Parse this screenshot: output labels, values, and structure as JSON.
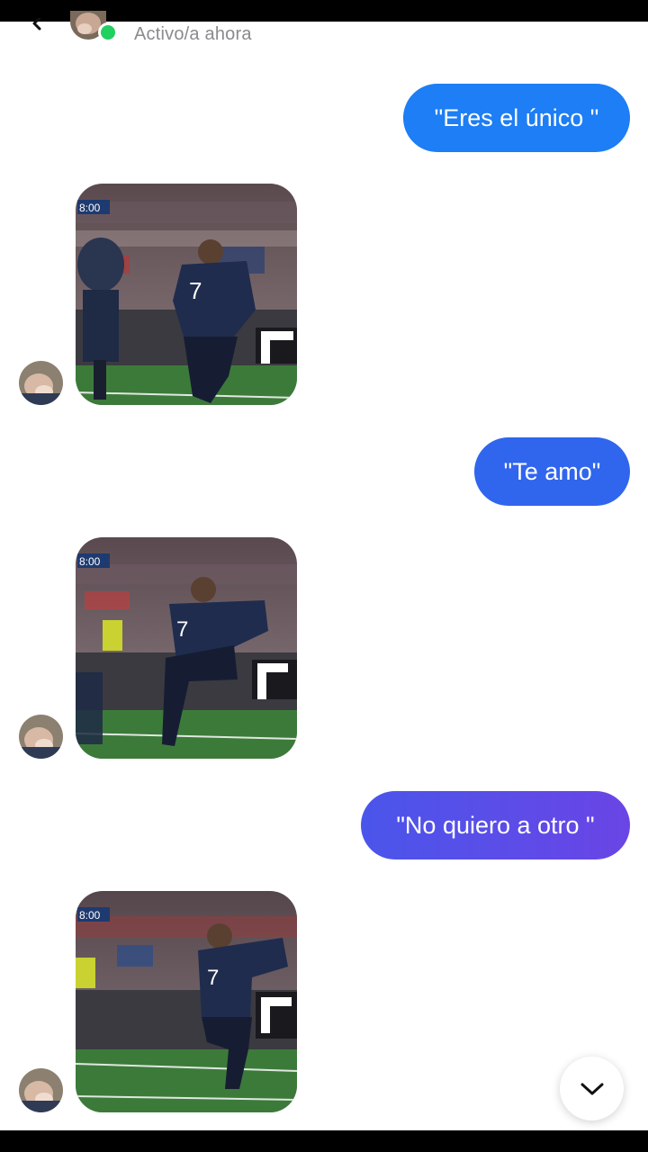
{
  "header": {
    "status_text": "Activo/a ahora",
    "back_icon": "chevron-left-icon",
    "online_color": "#20d060"
  },
  "messages": [
    {
      "type": "sent",
      "text": "\"Eres el único \""
    },
    {
      "type": "received_media",
      "clock": "8:00"
    },
    {
      "type": "sent",
      "text": "\"Te amo\""
    },
    {
      "type": "received_media",
      "clock": "8:00"
    },
    {
      "type": "sent",
      "text": "\"No quiero a otro \""
    },
    {
      "type": "received_media",
      "clock": "8:00"
    }
  ],
  "scroll_button": {
    "icon": "chevron-down-icon"
  },
  "colors": {
    "bubble_1": "#1d7ef5",
    "bubble_2": "#3065ee",
    "bubble_3": "#5a4de8",
    "status_text": "#8a8a8f"
  }
}
